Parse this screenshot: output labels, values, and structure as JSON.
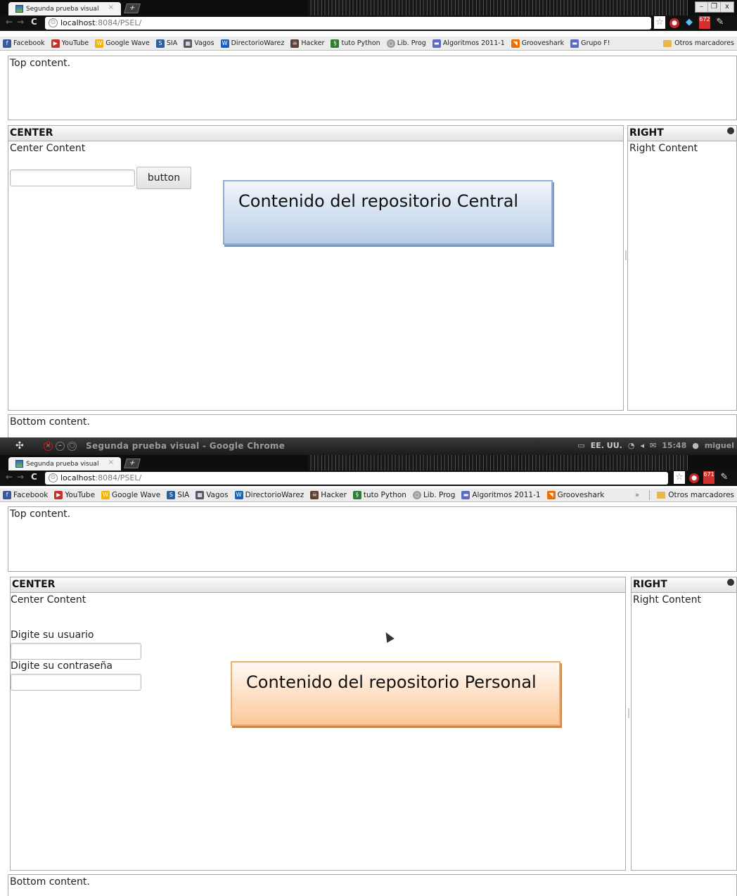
{
  "browser": {
    "tab_title": "Segunda prueba visual",
    "tab_close": "×",
    "new_tab": "+",
    "url_host": "localhost",
    "url_rest": ":8084/PSEL/",
    "window_controls": [
      "–",
      "❐",
      "x"
    ]
  },
  "os_bar": {
    "window_title": "Segunda prueba visual - Google Chrome",
    "tray_text": "EE. UU.",
    "clock": "15:48",
    "user": "miguel",
    "mail_count_1": "672",
    "mail_count_2": "671"
  },
  "bookmarks": [
    {
      "label": "Facebook",
      "icon": "facebook-icon"
    },
    {
      "label": "YouTube",
      "icon": "youtube-icon"
    },
    {
      "label": "Google Wave",
      "icon": "google-wave-icon"
    },
    {
      "label": "SIA",
      "icon": "sia-icon"
    },
    {
      "label": "Vagos",
      "icon": "vagos-icon"
    },
    {
      "label": "DirectorioWarez",
      "icon": "directoriowarez-icon"
    },
    {
      "label": "Hacker",
      "icon": "hacker-icon"
    },
    {
      "label": "tuto Python",
      "icon": "python-icon"
    },
    {
      "label": "Lib. Prog",
      "icon": "globe-icon"
    },
    {
      "label": "Algoritmos 2011-1",
      "icon": "page-icon"
    },
    {
      "label": "Grooveshark",
      "icon": "grooveshark-icon"
    },
    {
      "label": "Grupo F!",
      "icon": "page-icon"
    }
  ],
  "other_bookmarks": "Otros marcadores",
  "overflow_chevron": "»",
  "layout": {
    "top_content": "Top content.",
    "center_header": "CENTER",
    "center_content": "Center Content",
    "right_header": "RIGHT",
    "right_content": "Right Content",
    "bottom_content": "Bottom content."
  },
  "shot1": {
    "button_label": "button",
    "callout": "Contenido del repositorio Central"
  },
  "shot2": {
    "user_label": "Digite su usuario",
    "password_label": "Digite su contraseña",
    "callout": "Contenido del repositorio Personal"
  },
  "colors": {
    "blue_callout": "#b9cde8",
    "orange_callout": "#fcc899",
    "panel_border": "#a9a9a9"
  }
}
